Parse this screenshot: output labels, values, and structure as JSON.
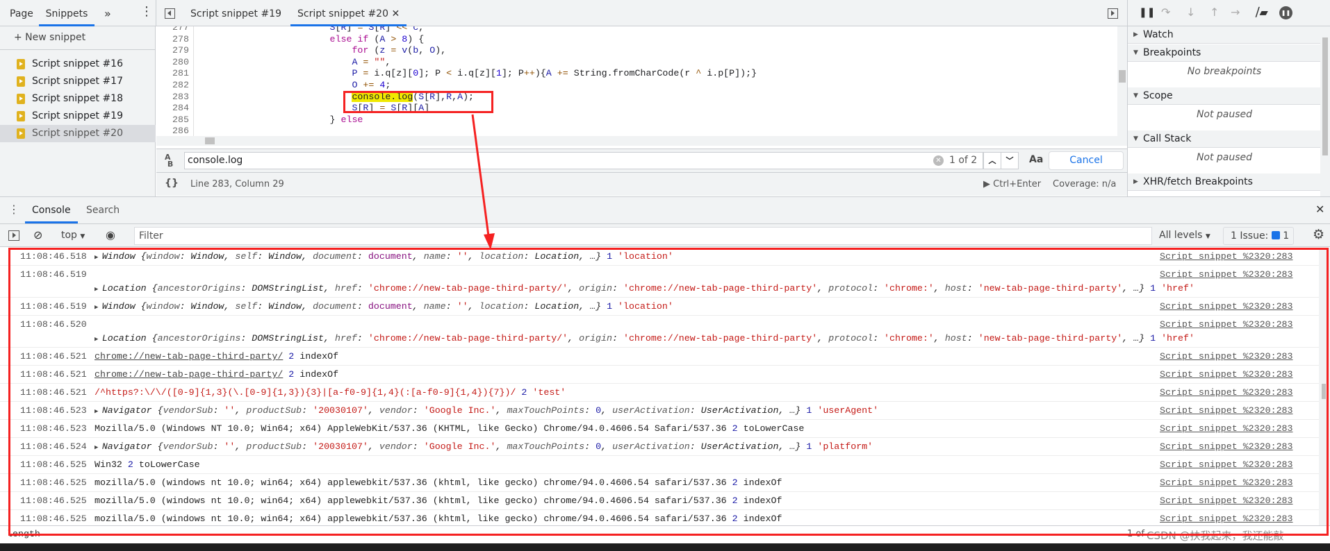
{
  "navigator": {
    "tabs": [
      "Page",
      "Snippets"
    ],
    "more": "»",
    "new_snippet": "+ New snippet",
    "snippets": [
      "Script snippet #16",
      "Script snippet #17",
      "Script snippet #18",
      "Script snippet #19",
      "Script snippet #20"
    ],
    "selected": 4
  },
  "editor": {
    "tabs": [
      "Script snippet #19",
      "Script snippet #20"
    ],
    "active_tab": 1,
    "lines": [
      {
        "n": "277",
        "tokens": [
          [
            "                        ",
            ""
          ],
          [
            "S",
            "id"
          ],
          [
            "[",
            ""
          ],
          [
            "R",
            "id"
          ],
          [
            "] ",
            ""
          ],
          [
            "=",
            "op"
          ],
          [
            " ",
            ""
          ],
          [
            "S",
            "id"
          ],
          [
            "[",
            ""
          ],
          [
            "R",
            "id"
          ],
          [
            "] ",
            ""
          ],
          [
            "<<",
            "op"
          ],
          [
            " ",
            ""
          ],
          [
            "c",
            "id"
          ],
          [
            ",",
            ""
          ]
        ]
      },
      {
        "n": "278",
        "tokens": [
          [
            "                        ",
            ""
          ],
          [
            "else if",
            "kw"
          ],
          [
            " (",
            ""
          ],
          [
            "A",
            "id"
          ],
          [
            " ",
            ""
          ],
          [
            ">",
            "op"
          ],
          [
            " ",
            ""
          ],
          [
            "8",
            "num"
          ],
          [
            ") {",
            ""
          ]
        ]
      },
      {
        "n": "279",
        "tokens": [
          [
            "                            ",
            ""
          ],
          [
            "for",
            "kw"
          ],
          [
            " (",
            ""
          ],
          [
            "z",
            "id"
          ],
          [
            " ",
            ""
          ],
          [
            "=",
            "op"
          ],
          [
            " ",
            ""
          ],
          [
            "v",
            "id"
          ],
          [
            "(",
            ""
          ],
          [
            "b",
            "id"
          ],
          [
            ", ",
            ""
          ],
          [
            "O",
            "id"
          ],
          [
            "),",
            ""
          ]
        ]
      },
      {
        "n": "280",
        "tokens": [
          [
            "                            ",
            ""
          ],
          [
            "A",
            "id"
          ],
          [
            " ",
            ""
          ],
          [
            "=",
            "op"
          ],
          [
            " ",
            ""
          ],
          [
            "\"\"",
            "str"
          ],
          [
            ",",
            ""
          ]
        ]
      },
      {
        "n": "281",
        "tokens": [
          [
            "                            ",
            ""
          ],
          [
            "P",
            "id"
          ],
          [
            " ",
            ""
          ],
          [
            "=",
            "op"
          ],
          [
            " i.q[z][",
            ""
          ],
          [
            "0",
            "num"
          ],
          [
            "]; P ",
            ""
          ],
          [
            "<",
            "op"
          ],
          [
            " i.q[z][",
            ""
          ],
          [
            "1",
            "num"
          ],
          [
            "]; P",
            ""
          ],
          [
            "++",
            "op"
          ],
          [
            "){",
            ""
          ],
          [
            "A",
            "id"
          ],
          [
            " ",
            ""
          ],
          [
            "+=",
            "op"
          ],
          [
            " String.fromCharCode(r ",
            ""
          ],
          [
            "^",
            "op"
          ],
          [
            " i.p[P]);}",
            ""
          ]
        ]
      },
      {
        "n": "282",
        "tokens": [
          [
            "                            ",
            ""
          ],
          [
            "O",
            "id"
          ],
          [
            " ",
            ""
          ],
          [
            "+=",
            "op"
          ],
          [
            " ",
            ""
          ],
          [
            "4",
            "num"
          ],
          [
            ";",
            ""
          ]
        ]
      },
      {
        "n": "283",
        "tokens": [
          [
            "                            ",
            ""
          ],
          [
            "console.log",
            "hl"
          ],
          [
            "(",
            ""
          ],
          [
            "S",
            "id"
          ],
          [
            "[",
            ""
          ],
          [
            "R",
            "id"
          ],
          [
            "],",
            ""
          ],
          [
            "R",
            "id"
          ],
          [
            ",",
            ""
          ],
          [
            "A",
            "id"
          ],
          [
            ");",
            ""
          ]
        ]
      },
      {
        "n": "284",
        "tokens": [
          [
            "                            ",
            ""
          ],
          [
            "S",
            "id"
          ],
          [
            "[",
            ""
          ],
          [
            "R",
            "id"
          ],
          [
            "] ",
            ""
          ],
          [
            "=",
            "op"
          ],
          [
            " ",
            ""
          ],
          [
            "S",
            "id"
          ],
          [
            "[",
            ""
          ],
          [
            "R",
            "id"
          ],
          [
            "][",
            ""
          ],
          [
            "A",
            "id"
          ],
          [
            "]",
            ""
          ]
        ]
      },
      {
        "n": "285",
        "tokens": [
          [
            "                        ",
            ""
          ],
          [
            "} ",
            ""
          ],
          [
            "else",
            "kw"
          ]
        ]
      },
      {
        "n": "286",
        "tokens": []
      }
    ]
  },
  "search": {
    "value": "console.log",
    "match_count": "1 of 2",
    "match_case": "Aa",
    "regex": ".*",
    "cancel": "Cancel"
  },
  "status": {
    "position": "Line 283, Column 29",
    "run": "Ctrl+Enter",
    "coverage": "Coverage: n/a"
  },
  "debugger": {
    "sections": [
      {
        "label": "Watch",
        "open": false
      },
      {
        "label": "Breakpoints",
        "open": true,
        "empty": "No breakpoints"
      },
      {
        "label": "Scope",
        "open": true,
        "empty": "Not paused"
      },
      {
        "label": "Call Stack",
        "open": true,
        "empty": "Not paused"
      },
      {
        "label": "XHR/fetch Breakpoints",
        "open": false
      }
    ]
  },
  "drawer": {
    "tabs": [
      "Console",
      "Search"
    ]
  },
  "console_toolbar": {
    "context": "top",
    "filter_placeholder": "Filter",
    "levels": "All levels",
    "issues": "1 Issue:",
    "issue_count": "1"
  },
  "messages": [
    {
      "time": "11:08:46.518",
      "wrap": false,
      "parts": [
        [
          "▶ ",
          "pre"
        ],
        [
          "Window {",
          "i"
        ],
        [
          "window",
          "k"
        ],
        [
          ": Window, ",
          "i"
        ],
        [
          "self",
          "k"
        ],
        [
          ": Window, ",
          "i"
        ],
        [
          "document",
          "k"
        ],
        [
          ": ",
          "i"
        ],
        [
          "document",
          "doc"
        ],
        [
          ", ",
          "i"
        ],
        [
          "name",
          "k"
        ],
        [
          ": ",
          "i"
        ],
        [
          "''",
          "s"
        ],
        [
          ", ",
          "i"
        ],
        [
          "location",
          "k"
        ],
        [
          ": Location, …}",
          "i"
        ],
        [
          " 1 ",
          "n"
        ],
        [
          "'location'",
          "s"
        ]
      ],
      "source": "Script snippet %2320:283"
    },
    {
      "time": "11:08:46.519",
      "wrap": true,
      "parts": [
        [
          "▶ ",
          "pre"
        ],
        [
          "Location {",
          "i"
        ],
        [
          "ancestorOrigins",
          "k"
        ],
        [
          ": DOMStringList, ",
          "i"
        ],
        [
          "href",
          "k"
        ],
        [
          ": ",
          "i"
        ],
        [
          "'chrome://new-tab-page-third-party/'",
          "s"
        ],
        [
          ", ",
          "i"
        ],
        [
          "origin",
          "k"
        ],
        [
          ": ",
          "i"
        ],
        [
          "'chrome://new-tab-page-third-party'",
          "s"
        ],
        [
          ", ",
          "i"
        ],
        [
          "protocol",
          "k"
        ],
        [
          ": ",
          "i"
        ],
        [
          "'chrome:'",
          "s"
        ],
        [
          ", ",
          "i"
        ],
        [
          "host",
          "k"
        ],
        [
          ": ",
          "i"
        ],
        [
          "'new-tab-page-third-party'",
          "s"
        ],
        [
          ", …}",
          "i"
        ],
        [
          " 1 ",
          "n"
        ],
        [
          "'href'",
          "s"
        ]
      ],
      "source": "Script snippet %2320:283"
    },
    {
      "time": "11:08:46.519",
      "wrap": false,
      "parts": [
        [
          "▶ ",
          "pre"
        ],
        [
          "Window {",
          "i"
        ],
        [
          "window",
          "k"
        ],
        [
          ": Window, ",
          "i"
        ],
        [
          "self",
          "k"
        ],
        [
          ": Window, ",
          "i"
        ],
        [
          "document",
          "k"
        ],
        [
          ": ",
          "i"
        ],
        [
          "document",
          "doc"
        ],
        [
          ", ",
          "i"
        ],
        [
          "name",
          "k"
        ],
        [
          ": ",
          "i"
        ],
        [
          "''",
          "s"
        ],
        [
          ", ",
          "i"
        ],
        [
          "location",
          "k"
        ],
        [
          ": Location, …}",
          "i"
        ],
        [
          " 1 ",
          "n"
        ],
        [
          "'location'",
          "s"
        ]
      ],
      "source": "Script snippet %2320:283"
    },
    {
      "time": "11:08:46.520",
      "wrap": true,
      "parts": [
        [
          "▶ ",
          "pre"
        ],
        [
          "Location {",
          "i"
        ],
        [
          "ancestorOrigins",
          "k"
        ],
        [
          ": DOMStringList, ",
          "i"
        ],
        [
          "href",
          "k"
        ],
        [
          ": ",
          "i"
        ],
        [
          "'chrome://new-tab-page-third-party/'",
          "s"
        ],
        [
          ", ",
          "i"
        ],
        [
          "origin",
          "k"
        ],
        [
          ": ",
          "i"
        ],
        [
          "'chrome://new-tab-page-third-party'",
          "s"
        ],
        [
          ", ",
          "i"
        ],
        [
          "protocol",
          "k"
        ],
        [
          ": ",
          "i"
        ],
        [
          "'chrome:'",
          "s"
        ],
        [
          ", ",
          "i"
        ],
        [
          "host",
          "k"
        ],
        [
          ": ",
          "i"
        ],
        [
          "'new-tab-page-third-party'",
          "s"
        ],
        [
          ", …}",
          "i"
        ],
        [
          " 1 ",
          "n"
        ],
        [
          "'href'",
          "s"
        ]
      ],
      "source": "Script snippet %2320:283"
    },
    {
      "time": "11:08:46.521",
      "wrap": false,
      "parts": [
        [
          "chrome://new-tab-page-third-party/",
          "u"
        ],
        [
          " 2 ",
          "n"
        ],
        [
          "indexOf",
          ""
        ]
      ],
      "source": "Script snippet %2320:283"
    },
    {
      "time": "11:08:46.521",
      "wrap": false,
      "parts": [
        [
          "chrome://new-tab-page-third-party/",
          "u"
        ],
        [
          " 2 ",
          "n"
        ],
        [
          "indexOf",
          ""
        ]
      ],
      "source": "Script snippet %2320:283"
    },
    {
      "time": "11:08:46.521",
      "wrap": false,
      "parts": [
        [
          "/^https?:\\/\\/([0-9]{1,3}(\\.[0-9]{1,3}){3}|[a-f0-9]{1,4}(:[a-f0-9]{1,4}){7})/",
          "s"
        ],
        [
          " 2 ",
          "n"
        ],
        [
          "'test'",
          "s"
        ]
      ],
      "source": "Script snippet %2320:283"
    },
    {
      "time": "11:08:46.523",
      "wrap": false,
      "parts": [
        [
          "▶ ",
          "pre"
        ],
        [
          "Navigator {",
          "i"
        ],
        [
          "vendorSub",
          "k"
        ],
        [
          ": ",
          "i"
        ],
        [
          "''",
          "s"
        ],
        [
          ", ",
          "i"
        ],
        [
          "productSub",
          "k"
        ],
        [
          ": ",
          "i"
        ],
        [
          "'20030107'",
          "s"
        ],
        [
          ", ",
          "i"
        ],
        [
          "vendor",
          "k"
        ],
        [
          ": ",
          "i"
        ],
        [
          "'Google Inc.'",
          "s"
        ],
        [
          ", ",
          "i"
        ],
        [
          "maxTouchPoints",
          "k"
        ],
        [
          ": ",
          "i"
        ],
        [
          "0",
          "n"
        ],
        [
          ", ",
          "i"
        ],
        [
          "userActivation",
          "k"
        ],
        [
          ": UserActivation, …}",
          "i"
        ],
        [
          " 1 ",
          "n"
        ],
        [
          "'userAgent'",
          "s"
        ]
      ],
      "source": "Script snippet %2320:283"
    },
    {
      "time": "11:08:46.523",
      "wrap": false,
      "parts": [
        [
          "Mozilla/5.0 (Windows NT 10.0; Win64; x64) AppleWebKit/537.36 (KHTML, like Gecko) Chrome/94.0.4606.54 Safari/537.36",
          ""
        ],
        [
          " 2 ",
          "n"
        ],
        [
          "toLowerCase",
          ""
        ]
      ],
      "source": "Script snippet %2320:283"
    },
    {
      "time": "11:08:46.524",
      "wrap": false,
      "parts": [
        [
          "▶ ",
          "pre"
        ],
        [
          "Navigator {",
          "i"
        ],
        [
          "vendorSub",
          "k"
        ],
        [
          ": ",
          "i"
        ],
        [
          "''",
          "s"
        ],
        [
          ", ",
          "i"
        ],
        [
          "productSub",
          "k"
        ],
        [
          ": ",
          "i"
        ],
        [
          "'20030107'",
          "s"
        ],
        [
          ", ",
          "i"
        ],
        [
          "vendor",
          "k"
        ],
        [
          ": ",
          "i"
        ],
        [
          "'Google Inc.'",
          "s"
        ],
        [
          ", ",
          "i"
        ],
        [
          "maxTouchPoints",
          "k"
        ],
        [
          ": ",
          "i"
        ],
        [
          "0",
          "n"
        ],
        [
          ", ",
          "i"
        ],
        [
          "userActivation",
          "k"
        ],
        [
          ": UserActivation, …}",
          "i"
        ],
        [
          " 1 ",
          "n"
        ],
        [
          "'platform'",
          "s"
        ]
      ],
      "source": "Script snippet %2320:283"
    },
    {
      "time": "11:08:46.525",
      "wrap": false,
      "parts": [
        [
          "Win32",
          ""
        ],
        [
          " 2 ",
          "n"
        ],
        [
          "toLowerCase",
          ""
        ]
      ],
      "source": "Script snippet %2320:283"
    },
    {
      "time": "11:08:46.525",
      "wrap": false,
      "parts": [
        [
          "mozilla/5.0 (windows nt 10.0; win64; x64) applewebkit/537.36 (khtml, like gecko) chrome/94.0.4606.54 safari/537.36",
          ""
        ],
        [
          " 2 ",
          "n"
        ],
        [
          "indexOf",
          ""
        ]
      ],
      "source": "Script snippet %2320:283"
    },
    {
      "time": "11:08:46.525",
      "wrap": false,
      "parts": [
        [
          "mozilla/5.0 (windows nt 10.0; win64; x64) applewebkit/537.36 (khtml, like gecko) chrome/94.0.4606.54 safari/537.36",
          ""
        ],
        [
          " 2 ",
          "n"
        ],
        [
          "indexOf",
          ""
        ]
      ],
      "source": "Script snippet %2320:283"
    },
    {
      "time": "11:08:46.525",
      "wrap": false,
      "parts": [
        [
          "mozilla/5.0 (windows nt 10.0; win64; x64) applewebkit/537.36 (khtml, like gecko) chrome/94.0.4606.54 safari/537.36",
          ""
        ],
        [
          " 2 ",
          "n"
        ],
        [
          "indexOf",
          ""
        ]
      ],
      "source": "Script snippet %2320:283"
    }
  ],
  "prompt": {
    "value": "length",
    "match_count": "1 of"
  },
  "watermark": "CSDN @扶我起来，我还能敲",
  "colors": {
    "accent": "#1a73e8",
    "annotation": "#f52121",
    "highlight": "#f0e900"
  }
}
